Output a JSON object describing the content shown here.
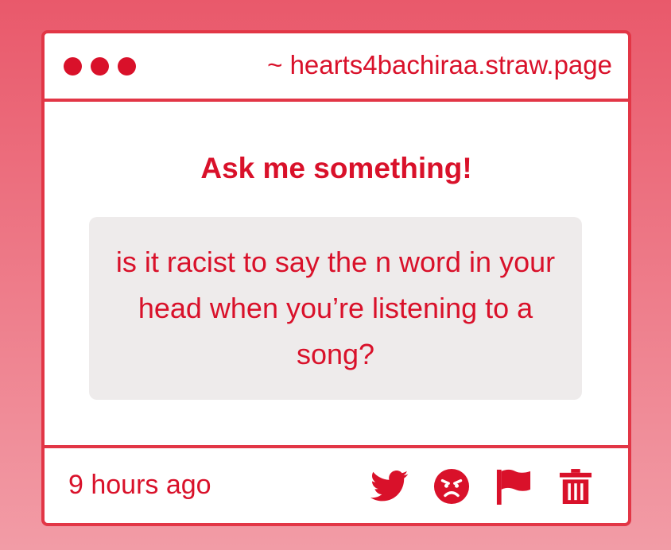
{
  "window": {
    "url": "~ hearts4bachiraa.straw.page"
  },
  "main": {
    "heading": "Ask me something!",
    "question": "is it racist to say the n word in your head when you’re listening to a song?"
  },
  "footer": {
    "timestamp": "9 hours ago",
    "actions": [
      {
        "icon": "twitter-icon"
      },
      {
        "icon": "angry-face-icon"
      },
      {
        "icon": "flag-icon"
      },
      {
        "icon": "trash-icon"
      }
    ]
  },
  "colors": {
    "accent": "#d9112a",
    "border": "#e23646",
    "question_bg": "#eeebeb",
    "background_top": "#e9596b",
    "background_bottom": "#f29ca6"
  }
}
